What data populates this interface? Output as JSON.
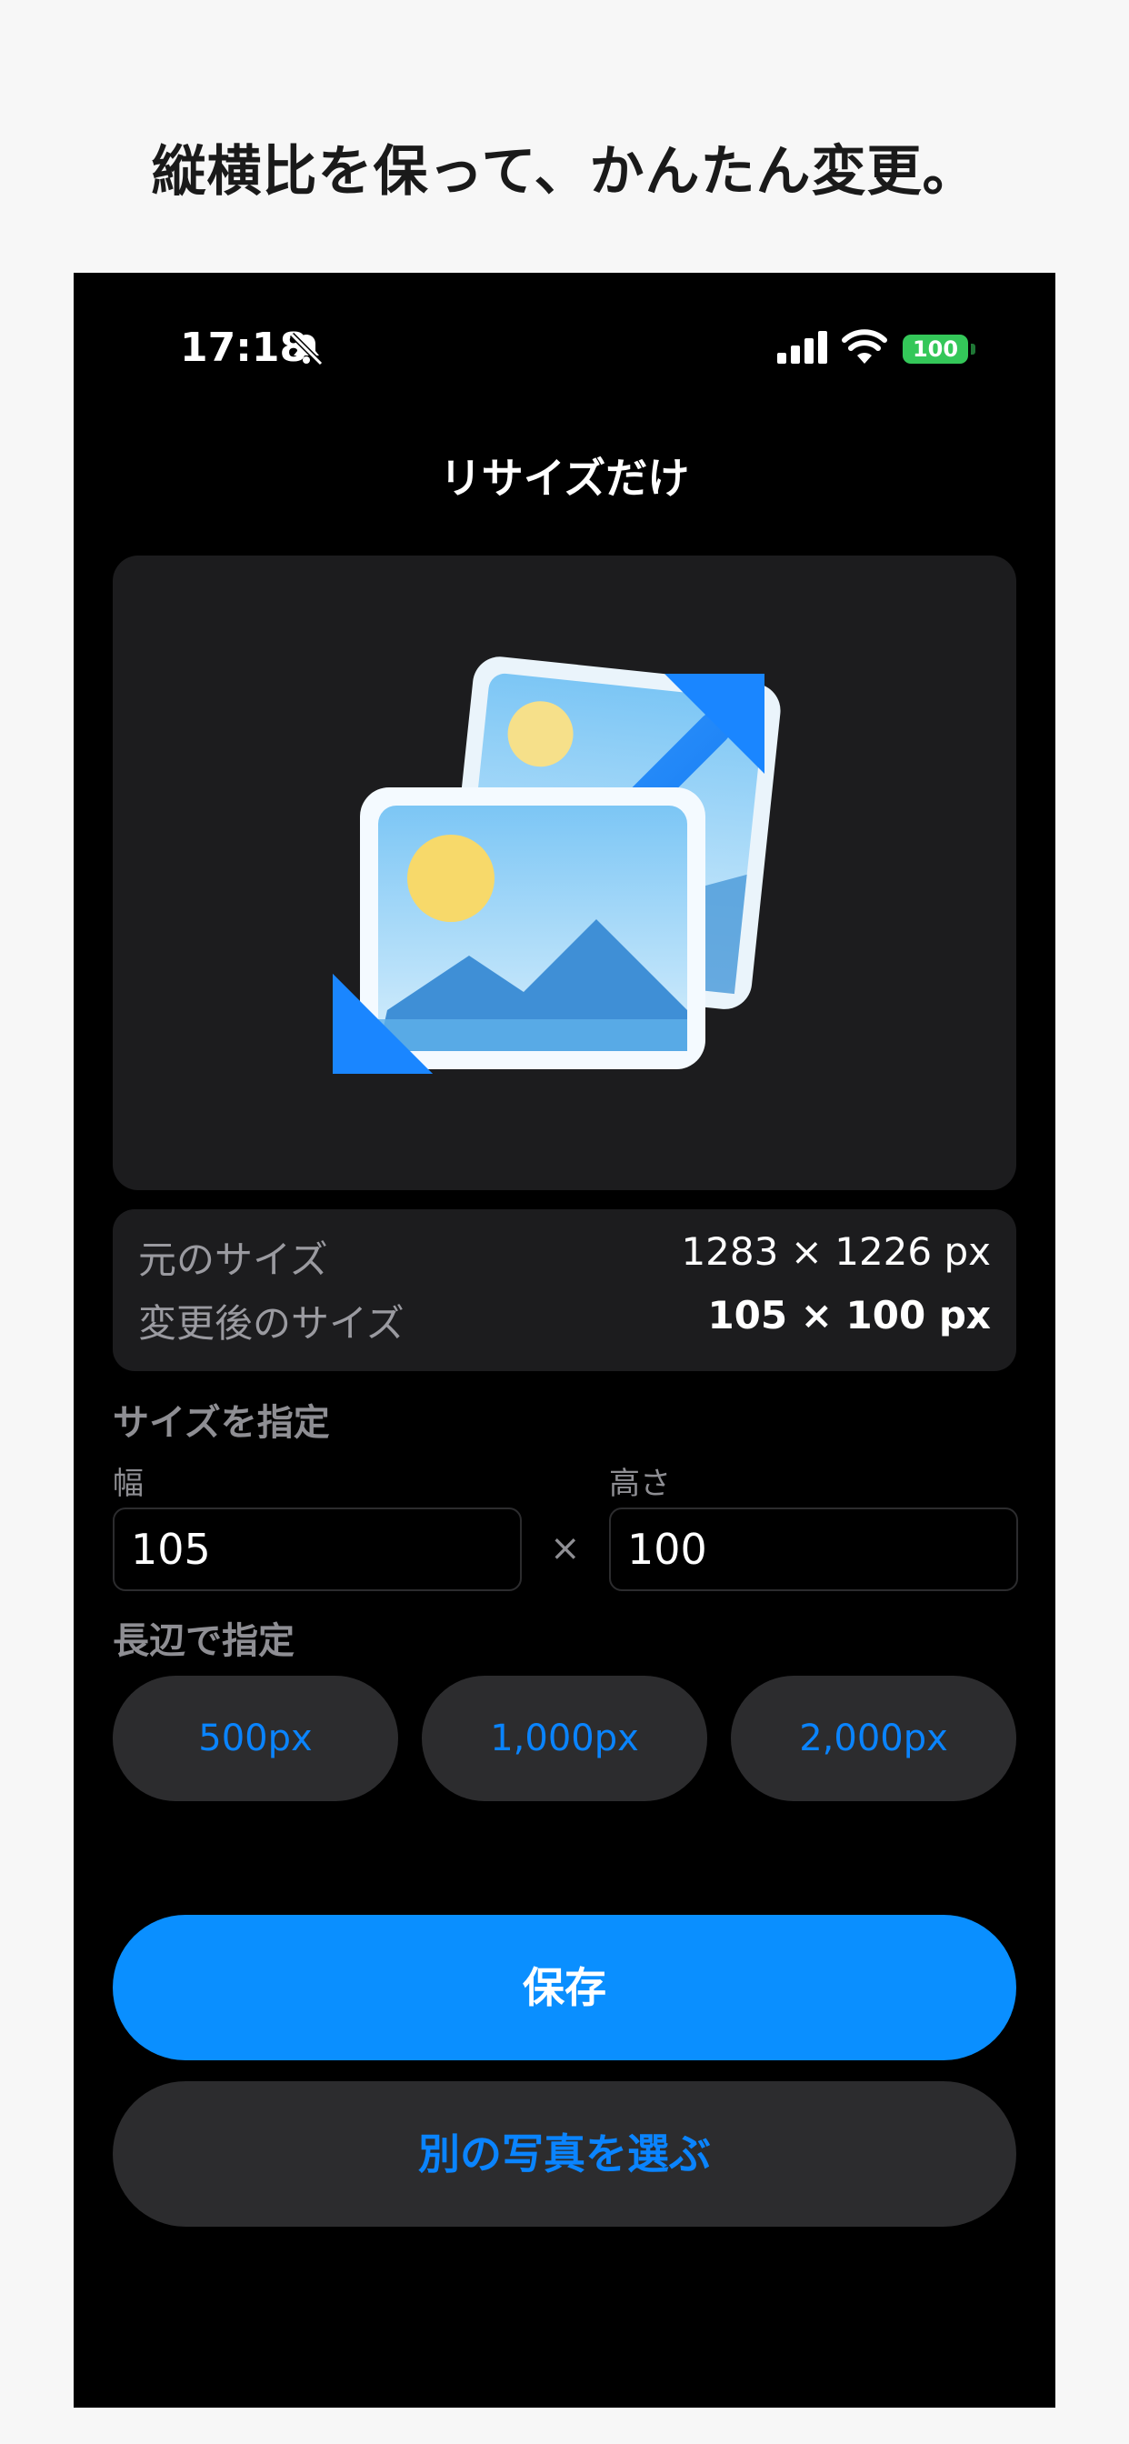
{
  "headline": "縦横比を保って、かんたん変更。",
  "status_bar": {
    "time": "17:18",
    "battery": "100",
    "icons": [
      "bell-slash-icon",
      "signal-icon",
      "wifi-icon",
      "battery-icon"
    ],
    "battery_color": "#34c759"
  },
  "nav": {
    "title": "リサイズだけ"
  },
  "preview": {
    "icon": "photo-resize-icon"
  },
  "size_info": {
    "original_label": "元のサイズ",
    "original_value": "1283 × 1226 px",
    "new_label": "変更後のサイズ",
    "new_value": "105 × 100 px"
  },
  "specify": {
    "section_title": "サイズを指定",
    "width_label": "幅",
    "width_value": "105",
    "height_label": "高さ",
    "height_value": "100",
    "separator": "×"
  },
  "long_edge": {
    "section_title": "長辺で指定",
    "options": [
      "500px",
      "1,000px",
      "2,000px"
    ]
  },
  "actions": {
    "save": "保存",
    "choose_another": "別の写真を選ぶ"
  },
  "colors": {
    "accent": "#0a84ff",
    "primary_button": "#0a8fff",
    "background": "#000000",
    "card": "#1c1c1e"
  }
}
